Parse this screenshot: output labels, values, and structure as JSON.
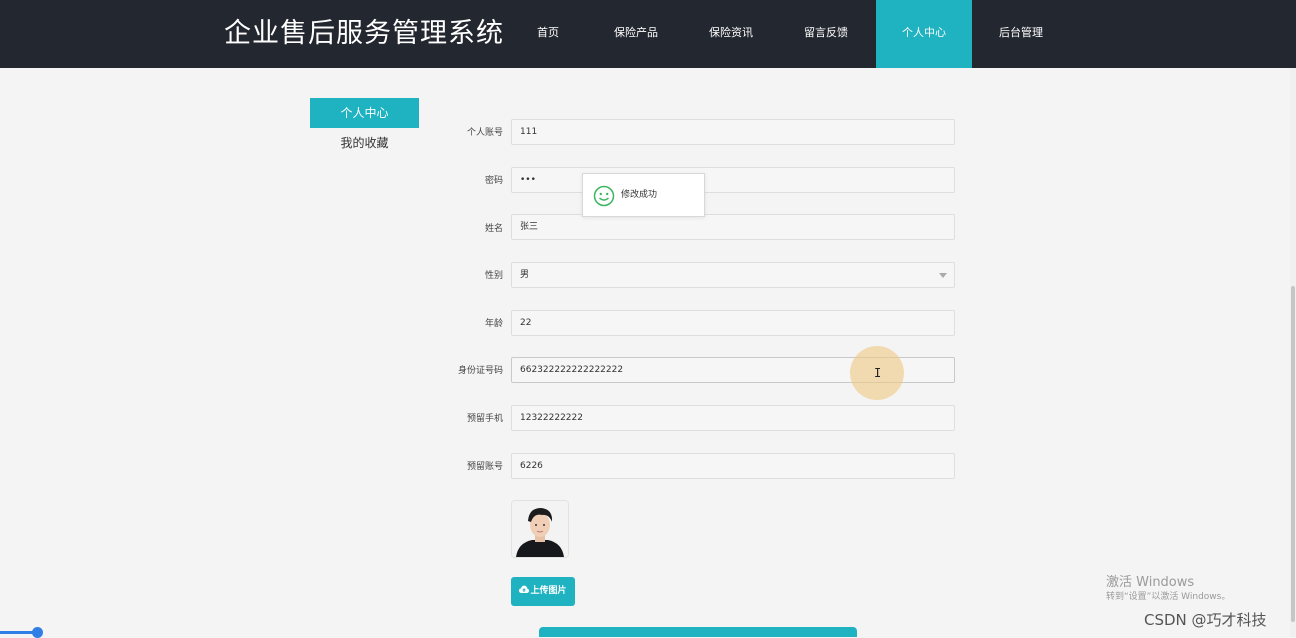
{
  "header": {
    "title": "企业售后服务管理系统",
    "nav": [
      "首页",
      "保险产品",
      "保险资讯",
      "留言反馈",
      "个人中心",
      "后台管理"
    ],
    "active_nav": "个人中心"
  },
  "sidebar": {
    "items": [
      {
        "label": "个人中心",
        "active": true
      },
      {
        "label": "我的收藏",
        "active": false
      }
    ]
  },
  "form": {
    "account": {
      "label": "个人账号",
      "value": "111"
    },
    "password": {
      "label": "密码",
      "value": "•••"
    },
    "name": {
      "label": "姓名",
      "value": "张三"
    },
    "gender": {
      "label": "性别",
      "value": "男"
    },
    "age": {
      "label": "年龄",
      "value": "22"
    },
    "id_number": {
      "label": "身份证号码",
      "value": "662322222222222222"
    },
    "phone": {
      "label": "预留手机",
      "value": "12322222222"
    },
    "bank_account": {
      "label": "预留账号",
      "value": "6226"
    },
    "upload_label": "上传图片"
  },
  "toast": {
    "message": "修改成功"
  },
  "watermark": {
    "title": "激活 Windows",
    "subtitle": "转到“设置”以激活 Windows。",
    "source": "CSDN @巧才科技"
  },
  "colors": {
    "accent": "#1fb2c1",
    "header_bg": "#23272f",
    "page_bg": "#f4f4f4"
  }
}
